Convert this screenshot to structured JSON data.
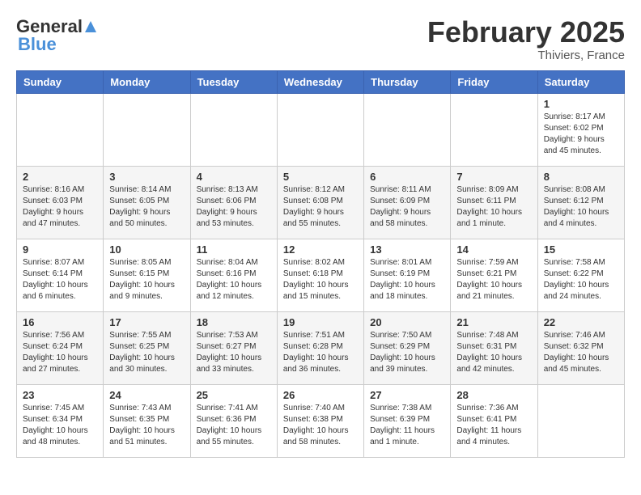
{
  "header": {
    "logo_general": "General",
    "logo_blue": "Blue",
    "month_title": "February 2025",
    "location": "Thiviers, France"
  },
  "days_of_week": [
    "Sunday",
    "Monday",
    "Tuesday",
    "Wednesday",
    "Thursday",
    "Friday",
    "Saturday"
  ],
  "weeks": [
    [
      {
        "day": "",
        "info": ""
      },
      {
        "day": "",
        "info": ""
      },
      {
        "day": "",
        "info": ""
      },
      {
        "day": "",
        "info": ""
      },
      {
        "day": "",
        "info": ""
      },
      {
        "day": "",
        "info": ""
      },
      {
        "day": "1",
        "info": "Sunrise: 8:17 AM\nSunset: 6:02 PM\nDaylight: 9 hours and 45 minutes."
      }
    ],
    [
      {
        "day": "2",
        "info": "Sunrise: 8:16 AM\nSunset: 6:03 PM\nDaylight: 9 hours and 47 minutes."
      },
      {
        "day": "3",
        "info": "Sunrise: 8:14 AM\nSunset: 6:05 PM\nDaylight: 9 hours and 50 minutes."
      },
      {
        "day": "4",
        "info": "Sunrise: 8:13 AM\nSunset: 6:06 PM\nDaylight: 9 hours and 53 minutes."
      },
      {
        "day": "5",
        "info": "Sunrise: 8:12 AM\nSunset: 6:08 PM\nDaylight: 9 hours and 55 minutes."
      },
      {
        "day": "6",
        "info": "Sunrise: 8:11 AM\nSunset: 6:09 PM\nDaylight: 9 hours and 58 minutes."
      },
      {
        "day": "7",
        "info": "Sunrise: 8:09 AM\nSunset: 6:11 PM\nDaylight: 10 hours and 1 minute."
      },
      {
        "day": "8",
        "info": "Sunrise: 8:08 AM\nSunset: 6:12 PM\nDaylight: 10 hours and 4 minutes."
      }
    ],
    [
      {
        "day": "9",
        "info": "Sunrise: 8:07 AM\nSunset: 6:14 PM\nDaylight: 10 hours and 6 minutes."
      },
      {
        "day": "10",
        "info": "Sunrise: 8:05 AM\nSunset: 6:15 PM\nDaylight: 10 hours and 9 minutes."
      },
      {
        "day": "11",
        "info": "Sunrise: 8:04 AM\nSunset: 6:16 PM\nDaylight: 10 hours and 12 minutes."
      },
      {
        "day": "12",
        "info": "Sunrise: 8:02 AM\nSunset: 6:18 PM\nDaylight: 10 hours and 15 minutes."
      },
      {
        "day": "13",
        "info": "Sunrise: 8:01 AM\nSunset: 6:19 PM\nDaylight: 10 hours and 18 minutes."
      },
      {
        "day": "14",
        "info": "Sunrise: 7:59 AM\nSunset: 6:21 PM\nDaylight: 10 hours and 21 minutes."
      },
      {
        "day": "15",
        "info": "Sunrise: 7:58 AM\nSunset: 6:22 PM\nDaylight: 10 hours and 24 minutes."
      }
    ],
    [
      {
        "day": "16",
        "info": "Sunrise: 7:56 AM\nSunset: 6:24 PM\nDaylight: 10 hours and 27 minutes."
      },
      {
        "day": "17",
        "info": "Sunrise: 7:55 AM\nSunset: 6:25 PM\nDaylight: 10 hours and 30 minutes."
      },
      {
        "day": "18",
        "info": "Sunrise: 7:53 AM\nSunset: 6:27 PM\nDaylight: 10 hours and 33 minutes."
      },
      {
        "day": "19",
        "info": "Sunrise: 7:51 AM\nSunset: 6:28 PM\nDaylight: 10 hours and 36 minutes."
      },
      {
        "day": "20",
        "info": "Sunrise: 7:50 AM\nSunset: 6:29 PM\nDaylight: 10 hours and 39 minutes."
      },
      {
        "day": "21",
        "info": "Sunrise: 7:48 AM\nSunset: 6:31 PM\nDaylight: 10 hours and 42 minutes."
      },
      {
        "day": "22",
        "info": "Sunrise: 7:46 AM\nSunset: 6:32 PM\nDaylight: 10 hours and 45 minutes."
      }
    ],
    [
      {
        "day": "23",
        "info": "Sunrise: 7:45 AM\nSunset: 6:34 PM\nDaylight: 10 hours and 48 minutes."
      },
      {
        "day": "24",
        "info": "Sunrise: 7:43 AM\nSunset: 6:35 PM\nDaylight: 10 hours and 51 minutes."
      },
      {
        "day": "25",
        "info": "Sunrise: 7:41 AM\nSunset: 6:36 PM\nDaylight: 10 hours and 55 minutes."
      },
      {
        "day": "26",
        "info": "Sunrise: 7:40 AM\nSunset: 6:38 PM\nDaylight: 10 hours and 58 minutes."
      },
      {
        "day": "27",
        "info": "Sunrise: 7:38 AM\nSunset: 6:39 PM\nDaylight: 11 hours and 1 minute."
      },
      {
        "day": "28",
        "info": "Sunrise: 7:36 AM\nSunset: 6:41 PM\nDaylight: 11 hours and 4 minutes."
      },
      {
        "day": "",
        "info": ""
      }
    ]
  ]
}
